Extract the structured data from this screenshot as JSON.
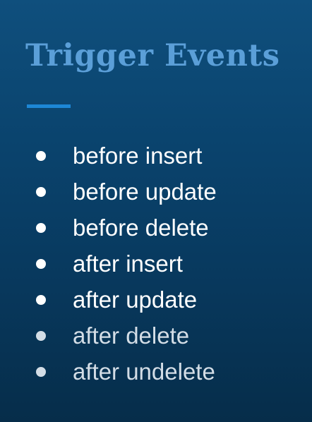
{
  "slide": {
    "title": "Trigger Events",
    "items": [
      {
        "label": "before insert"
      },
      {
        "label": "before update"
      },
      {
        "label": "before delete"
      },
      {
        "label": "after insert"
      },
      {
        "label": "after update"
      },
      {
        "label": "after delete"
      },
      {
        "label": "after undelete"
      }
    ]
  },
  "colors": {
    "background": "#0a436d",
    "title": "#5b9fd8",
    "accent": "#1d87d6",
    "text": "#ffffff"
  }
}
